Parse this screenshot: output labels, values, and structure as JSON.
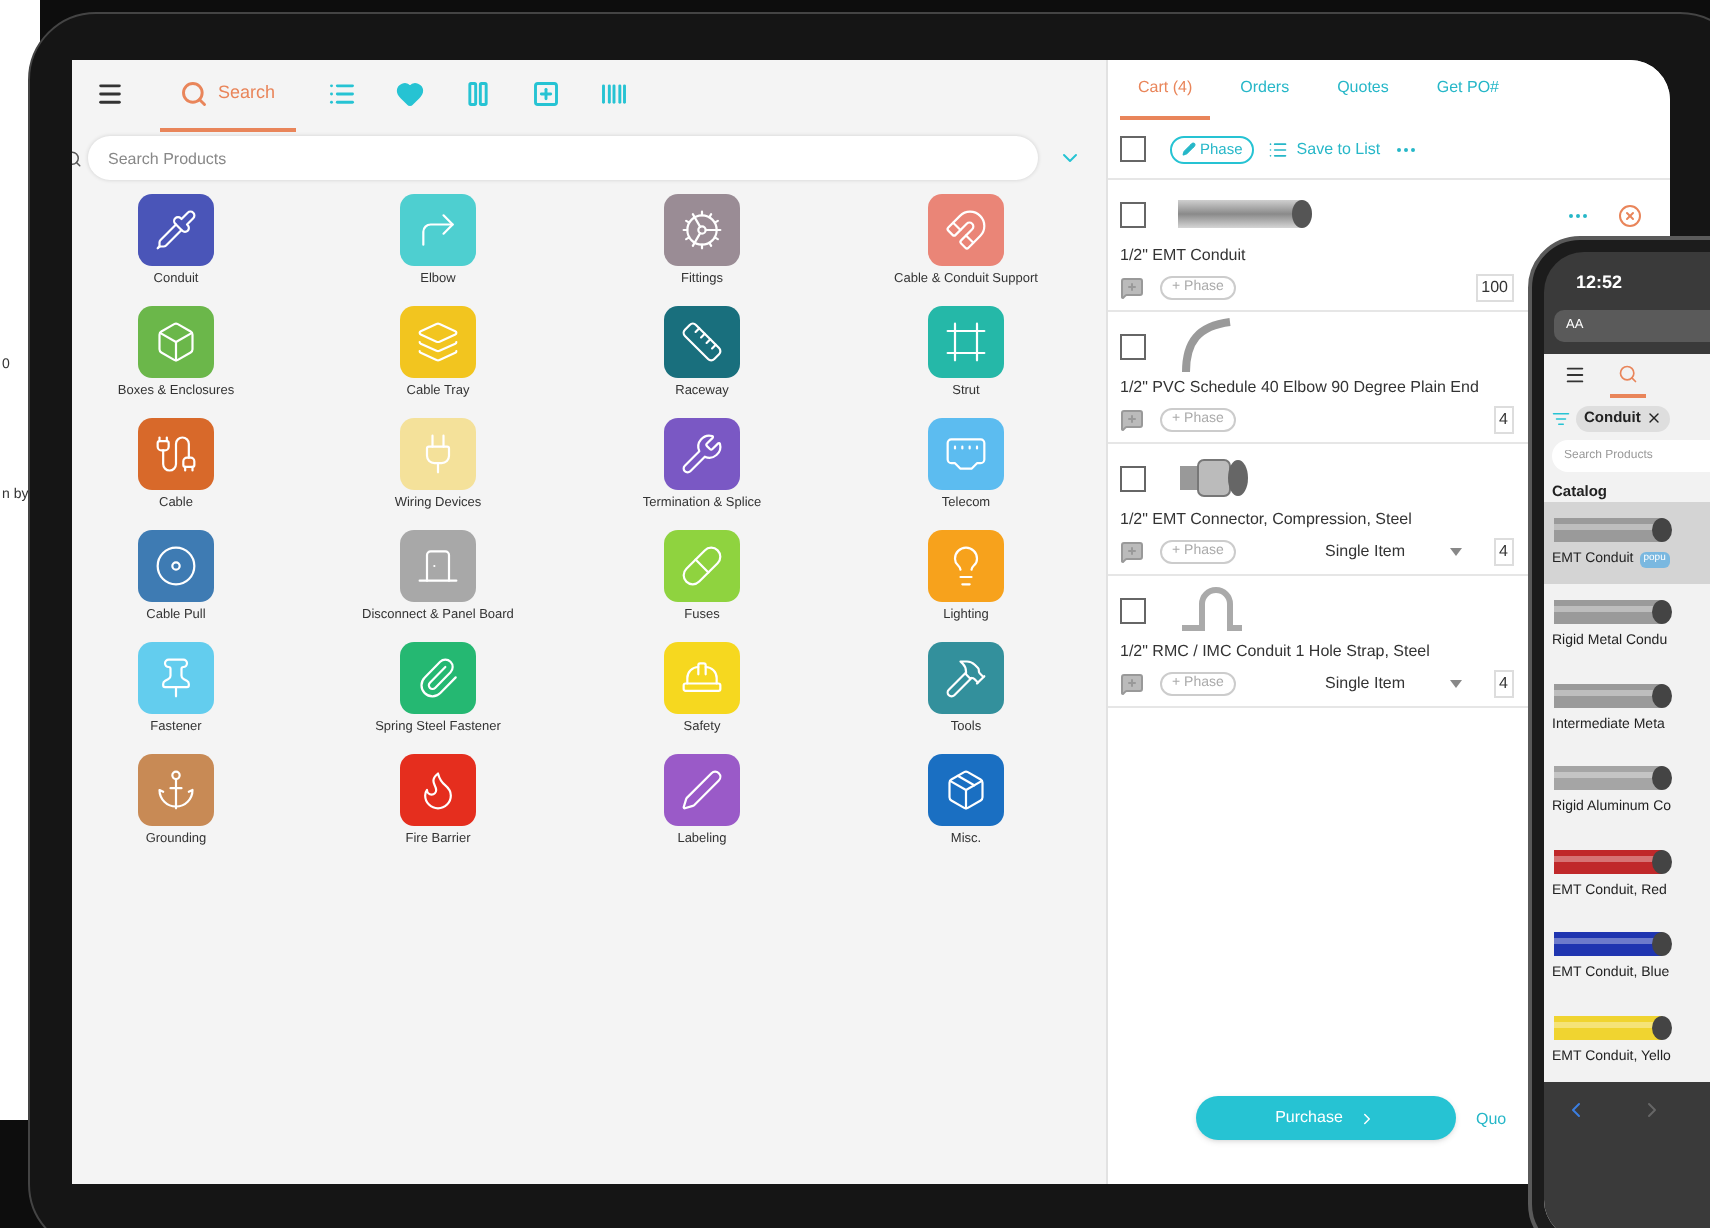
{
  "background_page": {
    "texts": [
      "0",
      "n by"
    ]
  },
  "left_tabs": [
    {
      "kind": "menu",
      "selected": false
    },
    {
      "kind": "search",
      "label": "Search",
      "selected": true
    },
    {
      "kind": "list",
      "selected": false
    },
    {
      "kind": "heart",
      "selected": false
    },
    {
      "kind": "columns",
      "selected": false
    },
    {
      "kind": "add",
      "selected": false
    },
    {
      "kind": "barcode",
      "selected": false
    }
  ],
  "search": {
    "placeholder": "Search Products"
  },
  "categories": [
    {
      "label": "Conduit",
      "color": "#4a55b8"
    },
    {
      "label": "Elbow",
      "color": "#4ecfd0"
    },
    {
      "label": "Fittings",
      "color": "#9a8c95"
    },
    {
      "label": "Cable & Conduit Support",
      "color": "#ea8577"
    },
    {
      "label": "Boxes & Enclosures",
      "color": "#6bb74a"
    },
    {
      "label": "Cable Tray",
      "color": "#f2c51f"
    },
    {
      "label": "Raceway",
      "color": "#196f7d"
    },
    {
      "label": "Strut",
      "color": "#25b8a8"
    },
    {
      "label": "Cable",
      "color": "#d8692a"
    },
    {
      "label": "Wiring Devices",
      "color": "#f4e19a"
    },
    {
      "label": "Termination & Splice",
      "color": "#7a58c4"
    },
    {
      "label": "Telecom",
      "color": "#5cbcf0"
    },
    {
      "label": "Cable Pull",
      "color": "#3e7bb3"
    },
    {
      "label": "Disconnect & Panel Board",
      "color": "#a8a8a8"
    },
    {
      "label": "Fuses",
      "color": "#8fd33f"
    },
    {
      "label": "Lighting",
      "color": "#f7a21c"
    },
    {
      "label": "Fastener",
      "color": "#63cdee"
    },
    {
      "label": "Spring Steel Fastener",
      "color": "#25b872"
    },
    {
      "label": "Safety",
      "color": "#f6d81f"
    },
    {
      "label": "Tools",
      "color": "#33909c"
    },
    {
      "label": "Grounding",
      "color": "#c88a55"
    },
    {
      "label": "Fire Barrier",
      "color": "#e52e1e"
    },
    {
      "label": "Labeling",
      "color": "#9a5ac8"
    },
    {
      "label": "Misc.",
      "color": "#1a6fc2"
    }
  ],
  "right_tabs": [
    {
      "label": "Cart (4)",
      "selected": true
    },
    {
      "label": "Orders",
      "selected": false
    },
    {
      "label": "Quotes",
      "selected": false
    },
    {
      "label": "Get PO#",
      "selected": false
    }
  ],
  "cart_toolbar": {
    "checked": false,
    "phase": "Phase",
    "save": "Save to List"
  },
  "cart_items": [
    {
      "name": "1/2\" EMT Conduit",
      "checked": false,
      "phase": "+ Phase",
      "quantity": "100",
      "actions": true
    },
    {
      "name": "1/2\" PVC Schedule 40 Elbow 90 Degree Plain End",
      "checked": false,
      "phase": "+ Phase",
      "quantity": "4"
    },
    {
      "name": "1/2\" EMT Connector, Compression, Steel",
      "checked": false,
      "phase": "+ Phase",
      "unit": "Single Item",
      "quantity": "4"
    },
    {
      "name": "1/2\" RMC / IMC Conduit 1 Hole Strap, Steel",
      "checked": false,
      "phase": "+ Phase",
      "unit": "Single Item",
      "quantity": "4"
    }
  ],
  "purchase": "Purchase",
  "quote_link": "Quo",
  "phone": {
    "time": "12:52",
    "address": "AA",
    "filter": "Conduit",
    "search": {
      "placeholder": "Search Products"
    },
    "section": "Catalog",
    "items": [
      {
        "label": "EMT Conduit",
        "color": "#9a9a9a",
        "selected": true,
        "badge": "popu"
      },
      {
        "label": "Rigid Metal Condu",
        "color": "#9a9a9a",
        "selected": false
      },
      {
        "label": "Intermediate Meta",
        "color": "#9a9a9a",
        "selected": false
      },
      {
        "label": "Rigid Aluminum Co",
        "color": "#a5a5a5",
        "selected": false
      },
      {
        "label": "EMT Conduit, Red",
        "color": "#c0282a",
        "selected": false
      },
      {
        "label": "EMT Conduit, Blue",
        "color": "#1f35b0",
        "selected": false
      },
      {
        "label": "EMT Conduit, Yello",
        "color": "#f0d430",
        "selected": false
      }
    ]
  }
}
